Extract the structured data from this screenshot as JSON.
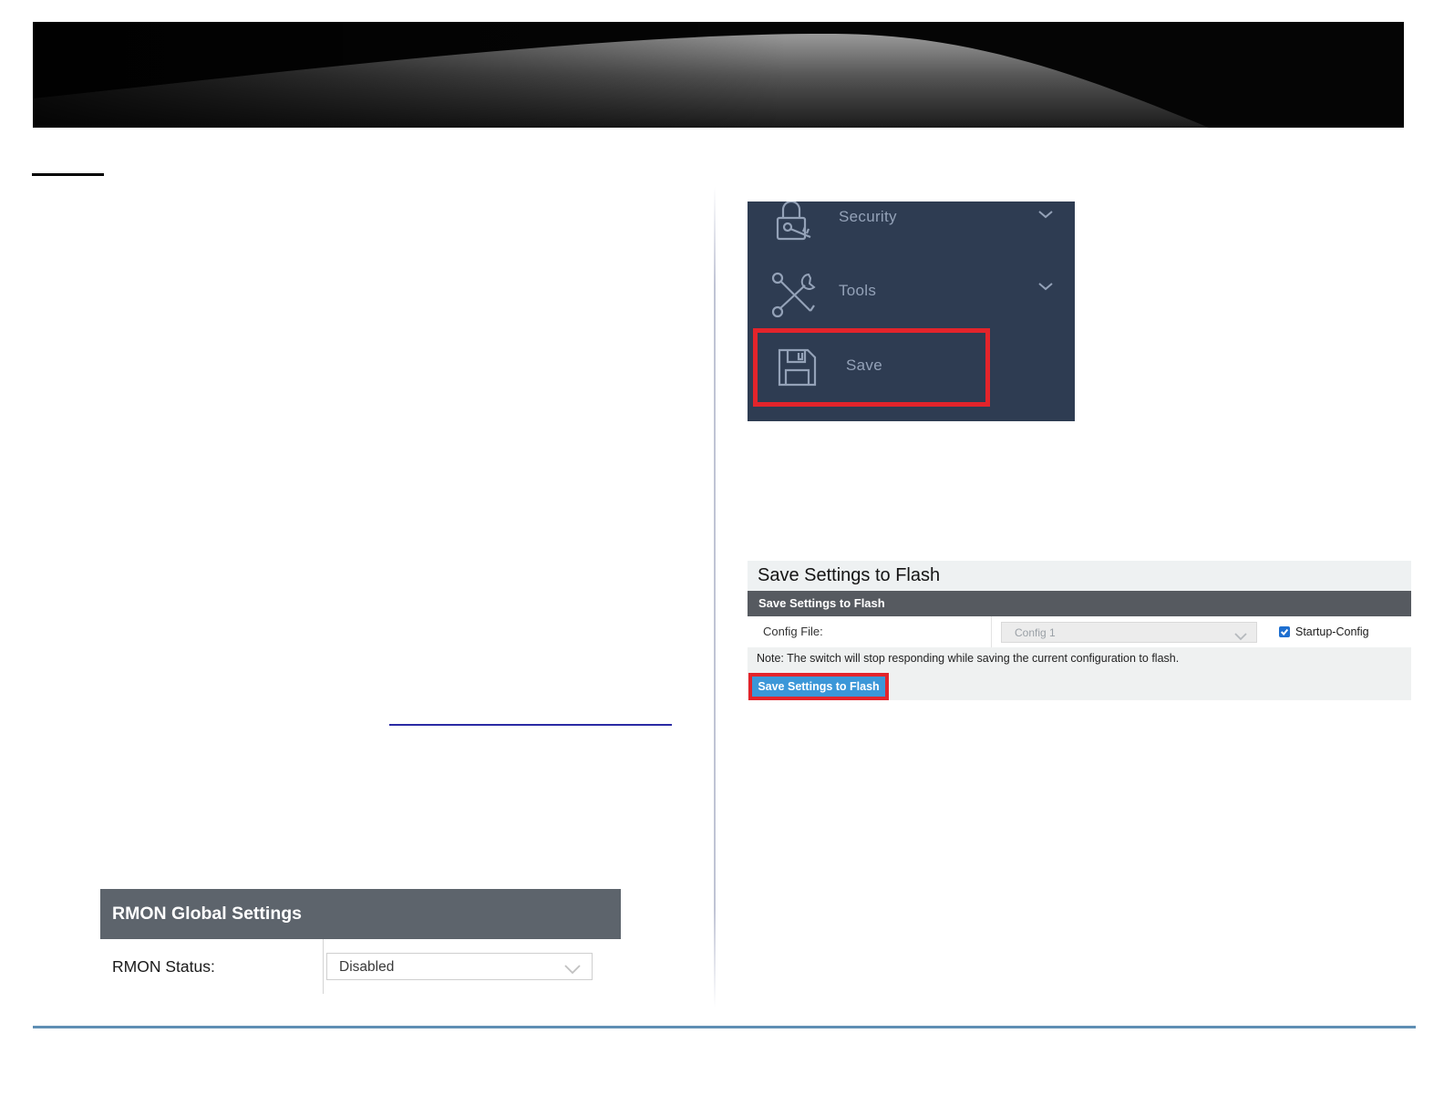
{
  "nav": {
    "items": [
      {
        "label": "Security",
        "icon": "lock-icon",
        "expandable": true
      },
      {
        "label": "Tools",
        "icon": "tools-icon",
        "expandable": true
      },
      {
        "label": "Save",
        "icon": "floppy-icon",
        "highlighted": true
      }
    ]
  },
  "save_panel": {
    "title": "Save Settings to Flash",
    "table_header": "Save Settings to Flash",
    "config_label": "Config File:",
    "config_value": "Config 1",
    "checkbox_label": "Startup-Config",
    "checkbox_checked": true,
    "note": "Note: The switch will stop responding while saving the current configuration to flash.",
    "button_label": "Save Settings to Flash"
  },
  "rmon_panel": {
    "header": "RMON Global Settings",
    "status_label": "RMON Status:",
    "status_value": "Disabled"
  },
  "colors": {
    "sidebar_bg": "#2e3c52",
    "sidebar_text": "#94a2b8",
    "highlight_red": "#e3242b",
    "header_dark": "#565a60",
    "rmon_header": "#5d646c",
    "button_blue": "#3b97d8",
    "checkbox_blue": "#1e6fd0",
    "footer_line": "#5f8fb4",
    "link_line": "#2a2aa4"
  }
}
